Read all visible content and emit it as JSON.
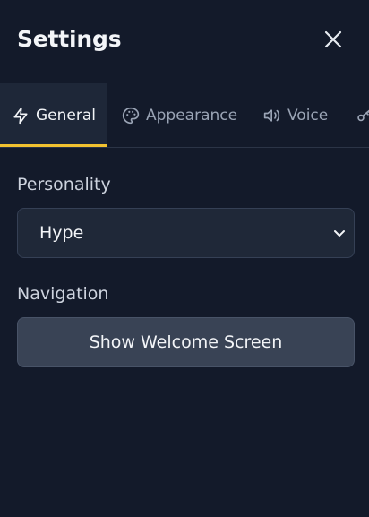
{
  "header": {
    "title": "Settings",
    "close_icon": "close-icon"
  },
  "tabs": [
    {
      "label": "General",
      "icon": "lightning-icon",
      "active": true
    },
    {
      "label": "Appearance",
      "icon": "palette-icon",
      "active": false
    },
    {
      "label": "Voice",
      "icon": "speaker-icon",
      "active": false
    },
    {
      "label": "",
      "icon": "key-icon",
      "active": false
    }
  ],
  "personality": {
    "label": "Personality",
    "selected": "Hype"
  },
  "navigation": {
    "label": "Navigation",
    "button_label": "Show Welcome Screen"
  },
  "colors": {
    "background": "#131a2a",
    "active_tab_bg": "#1e2738",
    "accent": "#f2c230",
    "button_bg": "#394355",
    "select_bg": "#1f2838"
  }
}
